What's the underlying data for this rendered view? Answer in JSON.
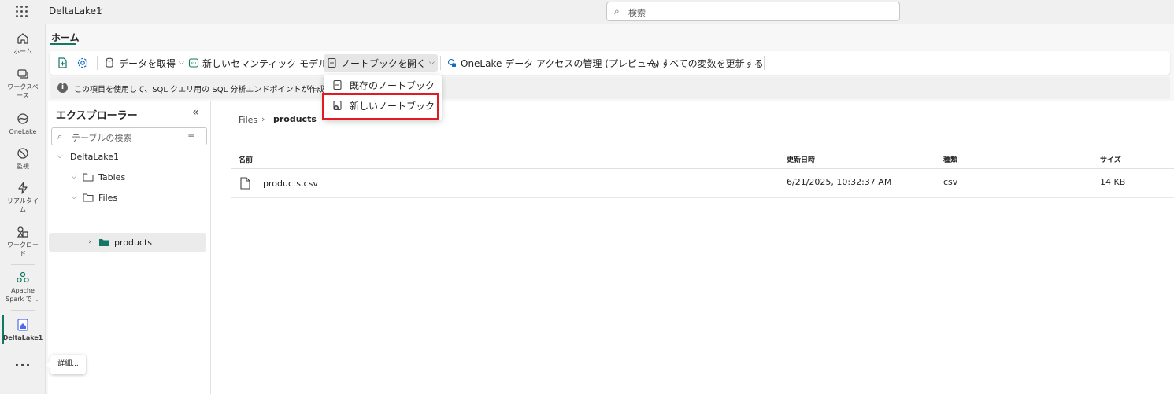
{
  "topbar": {
    "workspace_name": "DeltaLake1",
    "search_placeholder": "検索"
  },
  "rail": {
    "items": [
      {
        "label": "ホーム",
        "icon": "home-icon"
      },
      {
        "label": "ワークスペース",
        "label_line1": "ワークスペ",
        "label_line2": "ース",
        "icon": "workspaces-icon"
      },
      {
        "label": "OneLake",
        "icon": "onelake-icon"
      },
      {
        "label": "監視",
        "icon": "monitor-icon"
      },
      {
        "label": "リアルタイム",
        "label_line1": "リアルタイ",
        "label_line2": "ム",
        "icon": "realtime-icon"
      },
      {
        "label": "ワークロード",
        "label_line1": "ワークロー",
        "label_line2": "ド",
        "icon": "workloads-icon"
      },
      {
        "label": "Apache Spark で ...",
        "label_line1": "Apache",
        "label_line2": "Spark で ...",
        "icon": "spark-icon"
      },
      {
        "label": "DeltaLake1",
        "icon": "lakehouse-icon"
      }
    ],
    "more_label": "...",
    "more_tooltip": "詳細..."
  },
  "ribbon": {
    "tab_home": "ホーム",
    "get_data": "データを取得",
    "new_semantic_model": "新しいセマンティック モデル",
    "open_notebook": "ノートブックを開く",
    "onelake_access": "OneLake データ アクセスの管理 (プレビュー)",
    "refresh_all": "すべての変数を更新する"
  },
  "infobar": {
    "text": "この項目を使用して、SQL クエリ用の SQL 分析エンドポイントが作成され"
  },
  "explorer": {
    "title": "エクスプローラー",
    "search_placeholder": "テーブルの検索",
    "tree": {
      "root": "DeltaLake1",
      "tables": "Tables",
      "files": "Files",
      "products": "products"
    }
  },
  "content": {
    "breadcrumb": {
      "files": "Files",
      "current": "products"
    },
    "columns": {
      "name": "名前",
      "modified": "更新日時",
      "type": "種類",
      "size": "サイズ"
    },
    "rows": [
      {
        "name": "products.csv",
        "modified": "6/21/2025, 10:32:37 AM",
        "type": "csv",
        "size": "14 KB"
      }
    ]
  },
  "dropdown": {
    "existing_notebook": "既存のノートブック",
    "new_notebook": "新しいノートブック"
  },
  "colors": {
    "accent": "#117865",
    "highlight": "#e01b22",
    "folder": "#117865"
  }
}
